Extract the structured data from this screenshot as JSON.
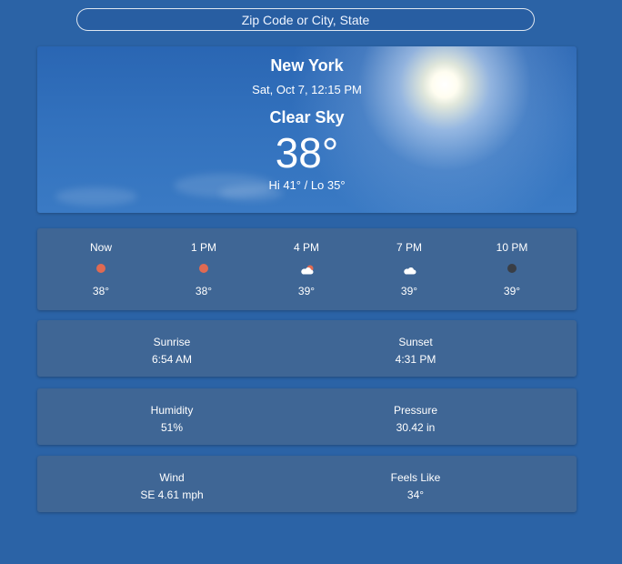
{
  "search": {
    "placeholder": "Zip Code or City, State"
  },
  "current": {
    "city": "New York",
    "datetime": "Sat, Oct 7, 12:15 PM",
    "condition": "Clear Sky",
    "temperature": "38°",
    "hi_lo": "Hi 41° / Lo 35°"
  },
  "hourly": [
    {
      "time": "Now",
      "temp": "38°",
      "icon": "sun-icon"
    },
    {
      "time": "1 PM",
      "temp": "38°",
      "icon": "sun-icon"
    },
    {
      "time": "4 PM",
      "temp": "39°",
      "icon": "partly-cloudy-icon"
    },
    {
      "time": "7 PM",
      "temp": "39°",
      "icon": "cloud-icon"
    },
    {
      "time": "10 PM",
      "temp": "39°",
      "icon": "moon-icon"
    }
  ],
  "sun": {
    "sunrise_label": "Sunrise",
    "sunrise_value": "6:54 AM",
    "sunset_label": "Sunset",
    "sunset_value": "4:31 PM"
  },
  "atmosphere": {
    "humidity_label": "Humidity",
    "humidity_value": "51%",
    "pressure_label": "Pressure",
    "pressure_value": "30.42 in"
  },
  "wind": {
    "wind_label": "Wind",
    "wind_value": "SE 4.61 mph",
    "feels_label": "Feels Like",
    "feels_value": "34°"
  },
  "colors": {
    "background": "#2b63a6",
    "card": "#3f6695",
    "sun_dot": "#e06a52",
    "moon_dot": "#393e46"
  }
}
